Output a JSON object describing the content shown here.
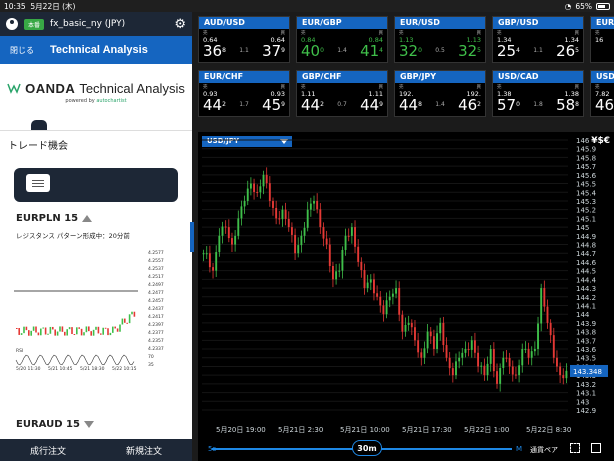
{
  "status": {
    "time": "10:35",
    "date": "5月22日 (木)",
    "battery": "65%"
  },
  "account": {
    "name": "fx_basic_ny (JPY)",
    "badge": "本番"
  },
  "panel": {
    "close": "閉じる",
    "title": "Technical Analysis"
  },
  "logo": {
    "brand": "OANDA",
    "product": "Technical Analysis",
    "powered": "powered by",
    "partner": "autochartist"
  },
  "trade": {
    "heading": "トレード機会",
    "pair1": "EURPLN 15",
    "pattern": "レジスタンス パターン形成中：20分前",
    "pair2": "EURAUD 15",
    "mini_prices": [
      "4.2577",
      "4.2557",
      "4.2537",
      "4.2517",
      "4.2497",
      "4.2477",
      "4.2457",
      "4.2437",
      "4.2417",
      "4.2397",
      "4.2377",
      "4.2357",
      "4.2337"
    ],
    "mini_rsi": [
      "70",
      "35"
    ],
    "mini_rsi_label": "RSI",
    "mini_dates": [
      "5/20 11:30",
      "5/21 10:45",
      "5/21 18:30",
      "5/22 10:15"
    ]
  },
  "bottom": {
    "left": "成行注文",
    "right": "新規注文"
  },
  "tickers": [
    {
      "pair": "AUD/USD",
      "sell": "売",
      "buy": "買",
      "bid_s": "0.64",
      "bid_b": "36",
      "bid_sup": "8",
      "ask_s": "0.64",
      "ask_b": "37",
      "ask_sup": "9",
      "spread": "1.1",
      "tone": "white"
    },
    {
      "pair": "EUR/GBP",
      "sell": "売",
      "buy": "買",
      "bid_s": "0.84",
      "bid_b": "40",
      "bid_sup": "0",
      "ask_s": "0.84",
      "ask_b": "41",
      "ask_sup": "4",
      "spread": "1.4",
      "tone": "green"
    },
    {
      "pair": "EUR/USD",
      "sell": "売",
      "buy": "買",
      "bid_s": "1.13",
      "bid_b": "32",
      "bid_sup": "0",
      "ask_s": "1.13",
      "ask_b": "32",
      "ask_sup": "5",
      "spread": "0.5",
      "tone": "green"
    },
    {
      "pair": "GBP/USD",
      "sell": "売",
      "buy": "買",
      "bid_s": "1.34",
      "bid_b": "25",
      "bid_sup": "4",
      "ask_s": "1.34",
      "ask_b": "26",
      "ask_sup": "5",
      "spread": "1.1",
      "tone": "white"
    },
    {
      "pair": "EUR/JPY",
      "sell": "売",
      "buy": "買",
      "bid_s": "16",
      "bid_b": "",
      "bid_sup": "",
      "ask_s": "",
      "ask_b": "",
      "ask_sup": "",
      "spread": "",
      "tone": "white"
    },
    {
      "pair": "EUR/CHF",
      "sell": "売",
      "buy": "買",
      "bid_s": "0.93",
      "bid_b": "44",
      "bid_sup": "2",
      "ask_s": "0.93",
      "ask_b": "45",
      "ask_sup": "9",
      "spread": "1.7",
      "tone": "white"
    },
    {
      "pair": "GBP/CHF",
      "sell": "売",
      "buy": "買",
      "bid_s": "1.11",
      "bid_b": "44",
      "bid_sup": "2",
      "ask_s": "1.11",
      "ask_b": "44",
      "ask_sup": "9",
      "spread": "0.7",
      "tone": "white"
    },
    {
      "pair": "GBP/JPY",
      "sell": "売",
      "buy": "買",
      "bid_s": "192.",
      "bid_b": "44",
      "bid_sup": "8",
      "ask_s": "192.",
      "ask_b": "46",
      "ask_sup": "2",
      "spread": "1.4",
      "tone": "white"
    },
    {
      "pair": "USD/CAD",
      "sell": "売",
      "buy": "買",
      "bid_s": "1.38",
      "bid_b": "57",
      "bid_sup": "0",
      "ask_s": "1.38",
      "ask_b": "58",
      "ask_sup": "8",
      "spread": "1.8",
      "tone": "white"
    },
    {
      "pair": "USD/",
      "sell": "売",
      "buy": "",
      "bid_s": "7.82",
      "bid_b": "46",
      "bid_sup": "",
      "ask_s": "",
      "ask_b": "",
      "ask_sup": "",
      "spread": "",
      "tone": "white"
    }
  ],
  "chart": {
    "symbol": "USD/JPY",
    "currency_icon": "¥$€",
    "last_price": "143.348",
    "price_labels": [
      "146",
      "145.9",
      "145.8",
      "145.7",
      "145.6",
      "145.5",
      "145.4",
      "145.3",
      "145.2",
      "145.1",
      "145",
      "144.9",
      "144.8",
      "144.7",
      "144.6",
      "144.5",
      "144.4",
      "144.3",
      "144.2",
      "144.1",
      "144",
      "143.9",
      "143.8",
      "143.7",
      "143.6",
      "143.5",
      "143.4",
      "143.3",
      "143.2",
      "143.1",
      "143",
      "142.9"
    ],
    "date_labels": [
      "5月20日 19:00",
      "5月21日 2:30",
      "5月21日 10:00",
      "5月21日 17:30",
      "5月22日 1:00",
      "5月22日 8:30"
    ],
    "interval": "30m",
    "left_end": "5s",
    "right_end": "M",
    "currency_pair_btn": "通貨ペア"
  },
  "chart_data": {
    "type": "candlestick",
    "series": [
      {
        "name": "USD/JPY",
        "values": [
          144.7,
          144.5,
          144.9,
          145.0,
          144.8,
          145.1,
          145.3,
          145.5,
          145.4,
          145.6,
          145.3,
          145.1,
          145.2,
          145.0,
          144.7,
          144.9,
          145.2,
          145.3,
          145.0,
          144.8,
          144.4,
          144.5,
          144.9,
          145.0,
          144.6,
          144.3,
          144.4,
          144.2,
          144.0,
          144.2,
          144.3,
          143.8,
          143.9,
          143.7,
          143.5,
          143.8,
          143.6,
          143.9,
          143.5,
          143.3,
          143.5,
          143.6,
          143.7,
          143.4,
          143.3,
          143.6,
          143.2,
          143.5,
          143.4,
          143.3,
          143.6,
          143.5,
          143.6,
          144.3,
          143.9,
          143.5,
          143.3,
          143.35
        ]
      }
    ],
    "ylim": [
      142.9,
      146.0
    ]
  }
}
